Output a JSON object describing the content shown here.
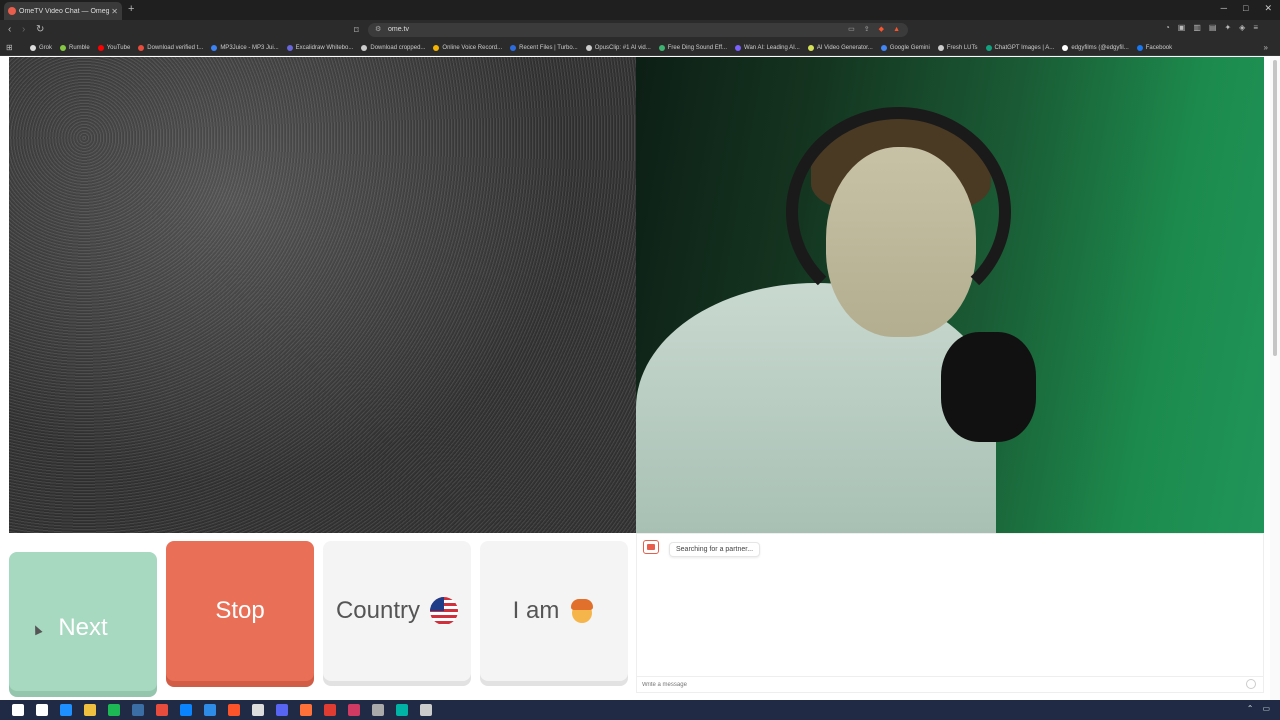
{
  "browser": {
    "tab_title": "OmeTV Video Chat — Omegle",
    "new_tab_label": "+",
    "url": "ome.tv",
    "window_controls": [
      "─",
      "□",
      "✕"
    ]
  },
  "bookmarks": [
    {
      "label": "Grok",
      "color": "#dddddd"
    },
    {
      "label": "Rumble",
      "color": "#85c742"
    },
    {
      "label": "YouTube",
      "color": "#ff0000"
    },
    {
      "label": "Download verified t...",
      "color": "#e74c3c"
    },
    {
      "label": "MP3Juice - MP3 Jui...",
      "color": "#3b82f6"
    },
    {
      "label": "Excalidraw Whitebo...",
      "color": "#6965db"
    },
    {
      "label": "Download cropped...",
      "color": "#cccccc"
    },
    {
      "label": "Online Voice Record...",
      "color": "#f4b400"
    },
    {
      "label": "Recent Files | Turbo...",
      "color": "#2d6cdf"
    },
    {
      "label": "OpusClip: #1 AI vid...",
      "color": "#cccccc"
    },
    {
      "label": "Free Ding Sound Eff...",
      "color": "#3cb371"
    },
    {
      "label": "Wan AI: Leading AI...",
      "color": "#7b61ff"
    },
    {
      "label": "AI Video Generator...",
      "color": "#d4e157"
    },
    {
      "label": "Google Gemini",
      "color": "#4285f4"
    },
    {
      "label": "Fresh LUTs",
      "color": "#cccccc"
    },
    {
      "label": "ChatGPT Images | A...",
      "color": "#10a37f"
    },
    {
      "label": "edgyfilms (@edgyfil...",
      "color": "#ffffff"
    },
    {
      "label": "Facebook",
      "color": "#1877f2"
    }
  ],
  "chat": {
    "status": "Searching for a partner...",
    "input_placeholder": "Write a message"
  },
  "controls": {
    "next": "Next",
    "stop": "Stop",
    "country": "Country",
    "iam": "I am"
  },
  "colors": {
    "next": "#a7d8c0",
    "stop": "#e96f57",
    "neutral": "#f4f4f4"
  },
  "taskbar_icons": [
    "#ffffff",
    "#ffffff",
    "#1e90ff",
    "#f0c040",
    "#1db954",
    "#3a6ea5",
    "#e84c3d",
    "#0a84ff",
    "#2f8ce6",
    "#fb542b",
    "#dddddd",
    "#5865f2",
    "#ff7139",
    "#e03c31",
    "#d13a63",
    "#aaaaaa",
    "#00b3a4",
    "#cccccc"
  ]
}
